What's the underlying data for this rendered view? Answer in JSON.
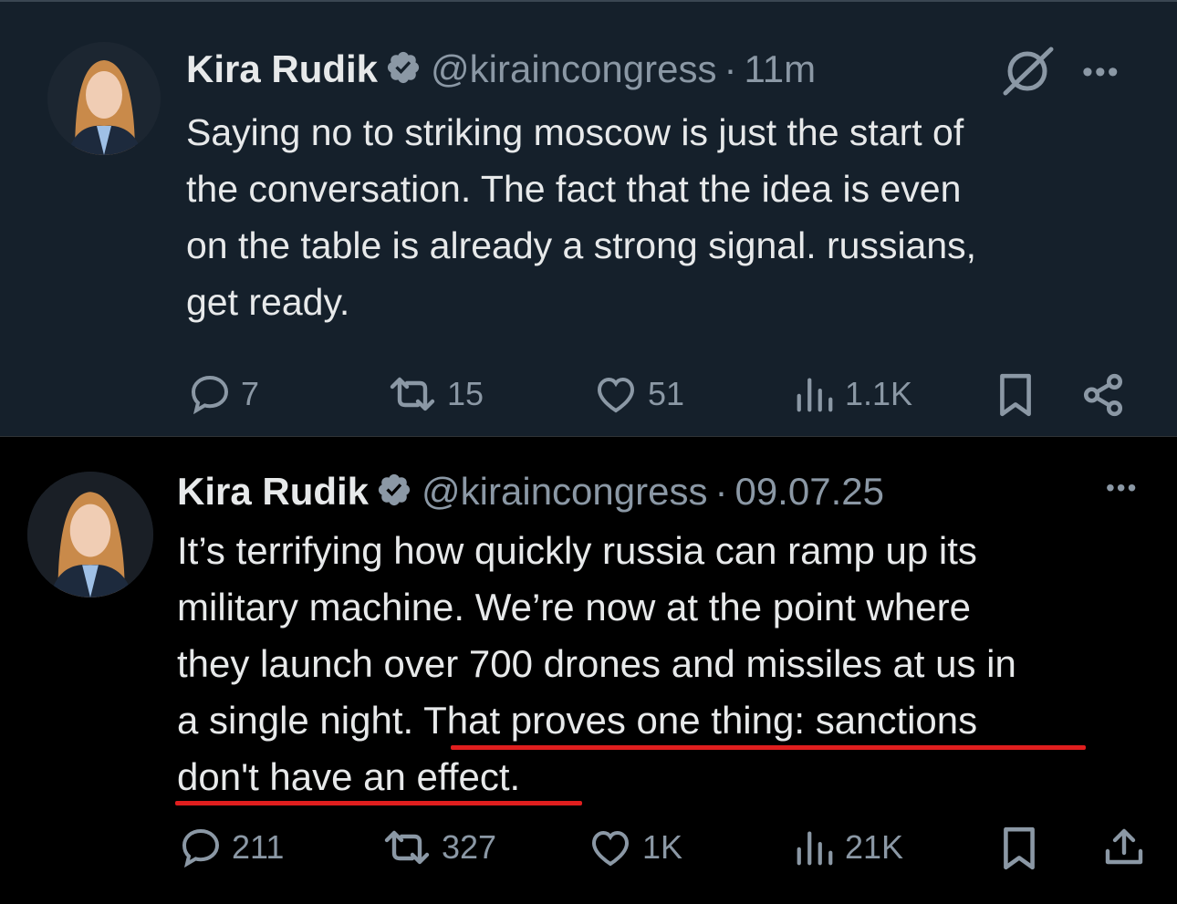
{
  "tweets": [
    {
      "name": "Kira Rudik",
      "handle": "@kiraincongress",
      "sep": "·",
      "time": "11m",
      "text_lines": [
        "Saying no to striking moscow is just the start of",
        "the conversation. The fact that the idea is even",
        "on the table is already a strong signal. russians,",
        "get ready."
      ],
      "replies": "7",
      "reposts": "15",
      "likes": "51",
      "views": "1.1K"
    },
    {
      "name": "Kira Rudik",
      "handle": "@kiraincongress",
      "sep": "·",
      "time": "09.07.25",
      "text_lines": [
        "It’s terrifying how quickly russia can ramp up its",
        "military machine. We’re now at the point where",
        "they launch over 700 drones and missiles at us in",
        "a single night. ",
        "That proves one thing: sanctions",
        "don't have an effect."
      ],
      "replies": "211",
      "reposts": "327",
      "likes": "1K",
      "views": "21K"
    }
  ],
  "more_label": "•••",
  "colors": {
    "dim_bg": "#15202b",
    "black_bg": "#000000",
    "text": "#e7e9ea",
    "muted": "#8b98a5",
    "verified_badge": "#8b98a5",
    "underline": "#e01e1e"
  }
}
